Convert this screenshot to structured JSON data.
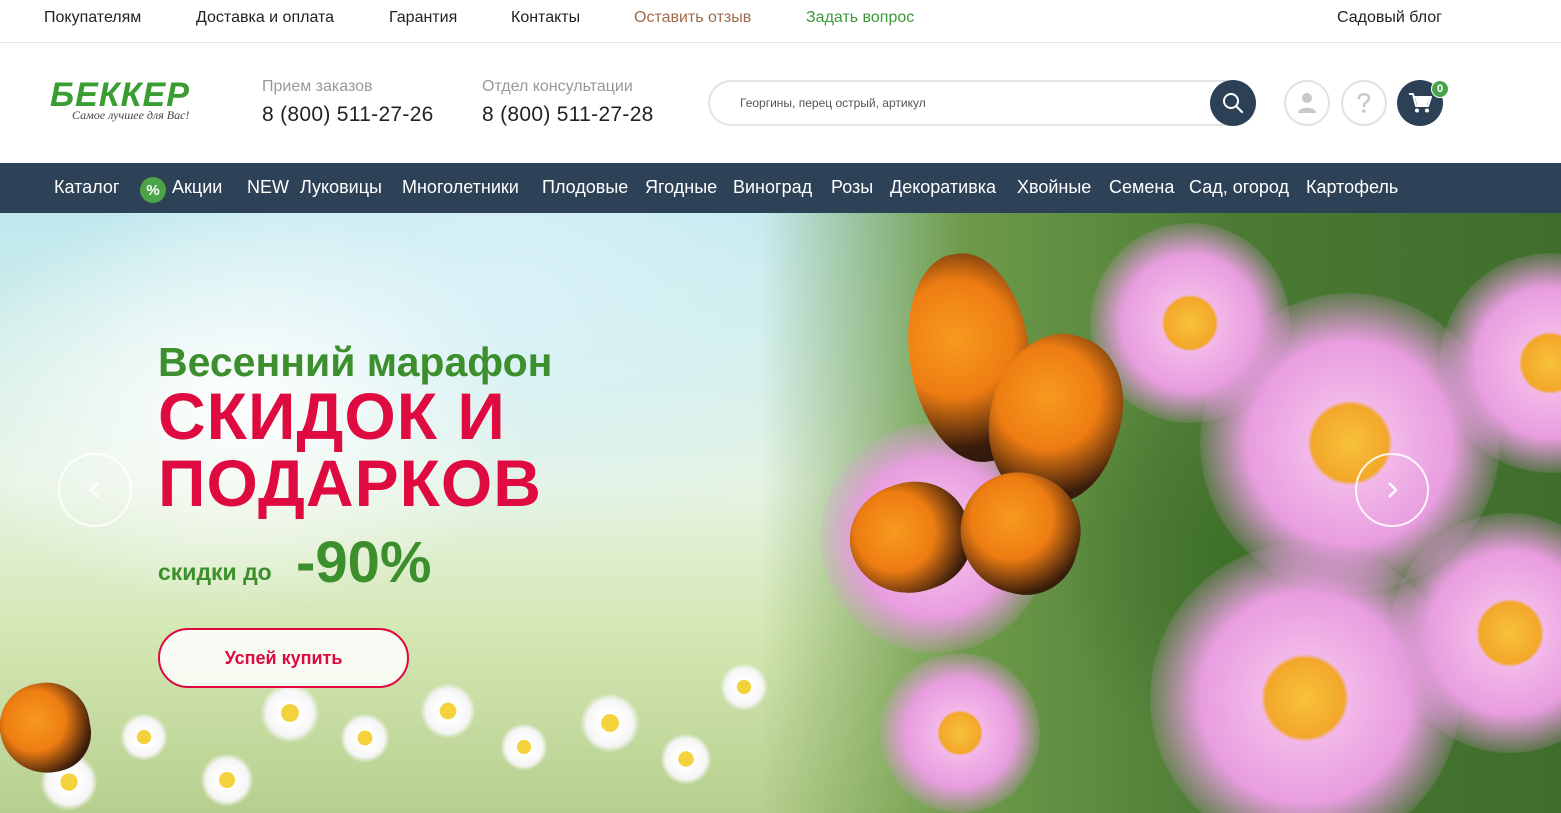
{
  "topbar": {
    "links": [
      "Покупателям",
      "Доставка и оплата",
      "Гарантия",
      "Контакты",
      "Оставить отзыв",
      "Задать вопрос"
    ],
    "blog": "Садовый блог",
    "review_color": "#a06a4a",
    "question_color": "#3c9a3c"
  },
  "header": {
    "logo": "БЕККЕР",
    "slogan": "Самое лучшее для Вас!",
    "orders_label": "Прием заказов",
    "orders_phone": "8 (800) 511-27-26",
    "consult_label": "Отдел консультации",
    "consult_phone": "8 (800) 511-27-28",
    "search_placeholder": "Георгины, перец острый, артикул",
    "cart_count": "0",
    "icons": [
      "search-icon",
      "user-icon",
      "help-icon",
      "cart-icon"
    ]
  },
  "nav": {
    "items": [
      "Каталог",
      "Акции",
      "NEW",
      "Луковицы",
      "Многолетники",
      "Плодовые",
      "Ягодные",
      "Виноград",
      "Розы",
      "Декоративка",
      "Хвойные",
      "Семена",
      "Сад, огород",
      "Картофель"
    ],
    "promo_badge": "%",
    "background": "#2e4257"
  },
  "hero": {
    "title": "Весенний марафон",
    "line1": "СКИДОК И",
    "line2": "ПОДАРКОВ",
    "discount_label": "скидки до",
    "discount_value": "-90%",
    "button": "Успей купить",
    "accent_red": "#df0a3f",
    "accent_green": "#3c8f2c"
  }
}
